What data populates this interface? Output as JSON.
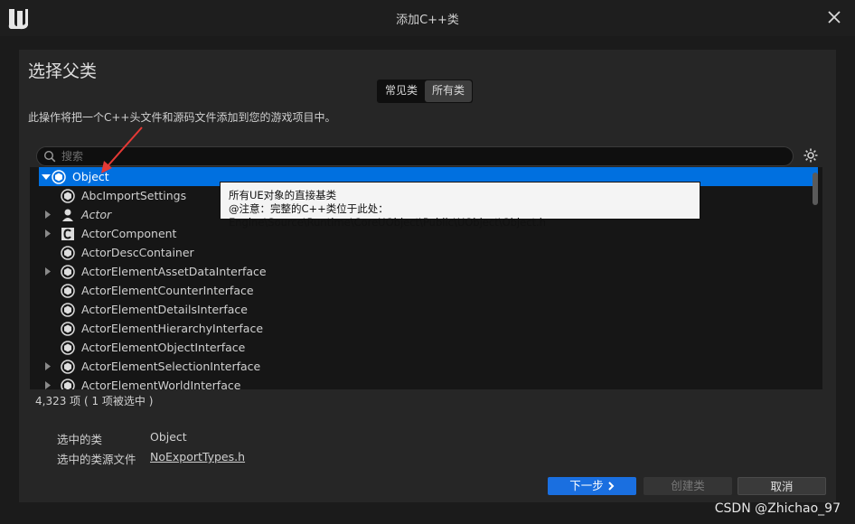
{
  "window": {
    "title": "添加C++类",
    "watermark": "CSDN @Zhichao_97"
  },
  "dialog": {
    "heading": "选择父类",
    "tabs": [
      "常见类",
      "所有类"
    ],
    "active_tab": "所有类",
    "description": "此操作将把一个C++头文件和源码文件添加到您的游戏项目中。"
  },
  "search": {
    "placeholder": "搜索",
    "value": ""
  },
  "tree": {
    "items": [
      {
        "label": "Object",
        "expanded": true,
        "selected": true,
        "icon": "object-icon"
      },
      {
        "label": "AbcImportSettings",
        "icon": "object-icon"
      },
      {
        "label": "Actor",
        "expandable": true,
        "italic": true,
        "icon": "actor-icon"
      },
      {
        "label": "ActorComponent",
        "expandable": true,
        "icon": "component-icon"
      },
      {
        "label": "ActorDescContainer",
        "icon": "object-icon"
      },
      {
        "label": "ActorElementAssetDataInterface",
        "expandable": true,
        "icon": "object-icon"
      },
      {
        "label": "ActorElementCounterInterface",
        "icon": "object-icon"
      },
      {
        "label": "ActorElementDetailsInterface",
        "icon": "object-icon"
      },
      {
        "label": "ActorElementHierarchyInterface",
        "icon": "object-icon"
      },
      {
        "label": "ActorElementObjectInterface",
        "icon": "object-icon"
      },
      {
        "label": "ActorElementSelectionInterface",
        "expandable": true,
        "icon": "object-icon"
      },
      {
        "label": "ActorElementWorldInterface",
        "expandable": true,
        "icon": "object-icon"
      }
    ]
  },
  "tooltip": {
    "line1": "所有UE对象的直接基类",
    "line2": "@注意：完整的C++类位于此处：Engine\\Source\\Runtime\\CoreUObject\\Public\\UObject\\Object.h"
  },
  "status": {
    "count": "4,323 项 ( 1 项被选中 )"
  },
  "selection": {
    "class_label": "选中的类",
    "class_value": "Object",
    "source_label": "选中的类源文件",
    "source_value": "NoExportTypes.h"
  },
  "buttons": {
    "next": "下一步",
    "create": "创建类",
    "cancel": "取消"
  },
  "colors": {
    "accent": "#0070e0",
    "annotation": "#e53935"
  }
}
